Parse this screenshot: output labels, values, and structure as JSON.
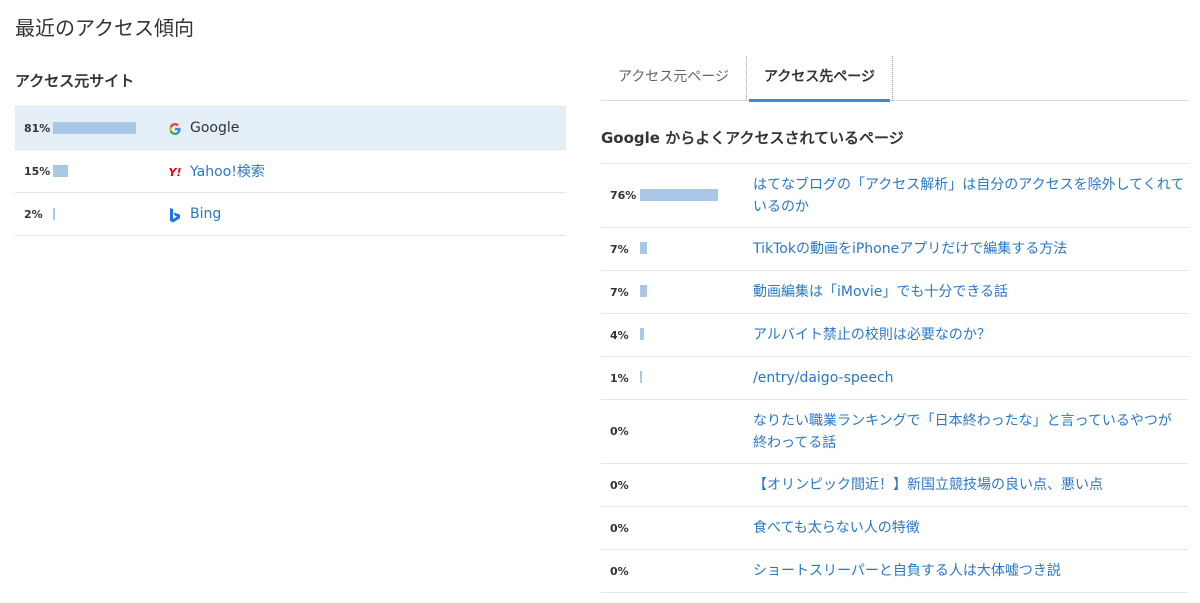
{
  "page": {
    "title": "最近のアクセス傾向"
  },
  "sources": {
    "title": "アクセス元サイト",
    "items": [
      {
        "percent": "81%",
        "fraction": 0.81,
        "label": "Google",
        "icon": "google-icon",
        "selected": true
      },
      {
        "percent": "15%",
        "fraction": 0.15,
        "label": "Yahoo!検索",
        "icon": "yahoo-icon",
        "selected": false
      },
      {
        "percent": "2%",
        "fraction": 0.02,
        "label": "Bing",
        "icon": "bing-icon",
        "selected": false
      }
    ]
  },
  "tabs": [
    {
      "label": "アクセス元ページ",
      "active": false
    },
    {
      "label": "アクセス先ページ",
      "active": true
    }
  ],
  "destinations": {
    "title": "Google からよくアクセスされているページ",
    "items": [
      {
        "percent": "76%",
        "fraction": 0.76,
        "label": "はてなブログの「アクセス解析」は自分のアクセスを除外してくれているのか",
        "lines": 2
      },
      {
        "percent": "7%",
        "fraction": 0.07,
        "label": "TikTokの動画をiPhoneアプリだけで編集する方法",
        "lines": 1
      },
      {
        "percent": "7%",
        "fraction": 0.07,
        "label": "動画編集は「iMovie」でも十分できる話",
        "lines": 1
      },
      {
        "percent": "4%",
        "fraction": 0.04,
        "label": "アルバイト禁止の校則は必要なのか？",
        "lines": 1
      },
      {
        "percent": "1%",
        "fraction": 0.01,
        "label": "/entry/daigo-speech",
        "lines": 1
      },
      {
        "percent": "0%",
        "fraction": 0,
        "label": "なりたい職業ランキングで「日本終わったな」と言っているやつが終わってる話",
        "lines": 2
      },
      {
        "percent": "0%",
        "fraction": 0,
        "label": "【オリンピック間近！】新国立競技場の良い点、悪い点",
        "lines": 1
      },
      {
        "percent": "0%",
        "fraction": 0,
        "label": "食べても太らない人の特徴",
        "lines": 1
      },
      {
        "percent": "0%",
        "fraction": 0,
        "label": "ショートスリーパーと自負する人は大体嘘つき説",
        "lines": 1
      }
    ]
  },
  "colors": {
    "bar": "#a9c8e8",
    "link": "#2a78c8",
    "selected_row": "#e3eef6",
    "tab_accent": "#3b8ad8"
  }
}
